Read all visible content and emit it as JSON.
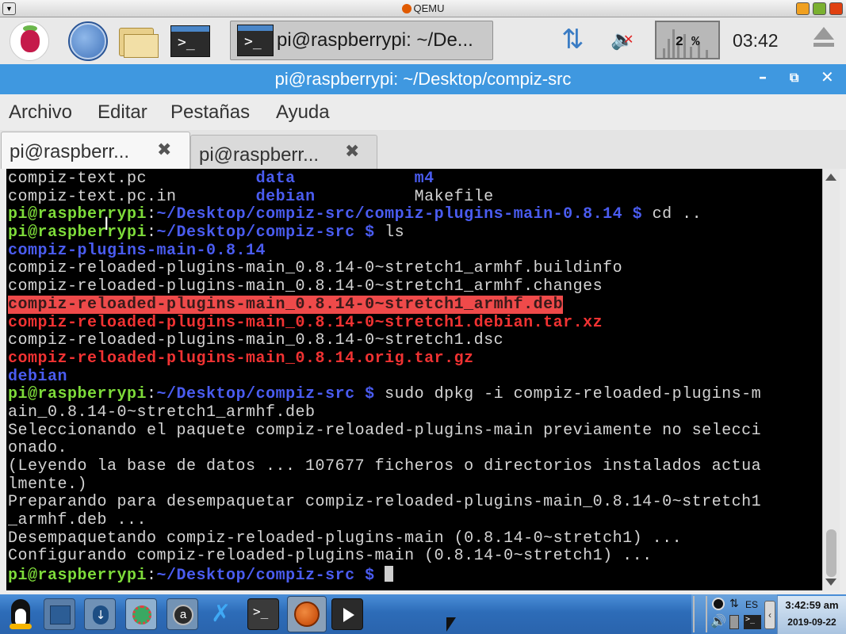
{
  "qemu": {
    "title": "QEMU"
  },
  "panel": {
    "task_label": "pi@raspberrypi: ~/De...",
    "cpu_label": "2 %",
    "clock": "03:42"
  },
  "window": {
    "title": "pi@raspberrypi: ~/Desktop/compiz-src",
    "menu": [
      "Archivo",
      "Editar",
      "Pestañas",
      "Ayuda"
    ],
    "tabs": [
      {
        "label": "pi@raspberr...",
        "active": true
      },
      {
        "label": "pi@raspberr...",
        "active": false
      }
    ]
  },
  "terminal": {
    "lines": [
      [
        {
          "t": "compiz-text.pc           ",
          "c": "white"
        },
        {
          "t": "data",
          "c": "dir"
        },
        {
          "t": "            ",
          "c": "white"
        },
        {
          "t": "m4",
          "c": "dir"
        }
      ],
      [
        {
          "t": "compiz-text.pc.in        ",
          "c": "white"
        },
        {
          "t": "debian",
          "c": "dir"
        },
        {
          "t": "          Makefile",
          "c": "white"
        }
      ],
      [
        {
          "t": "pi@raspberrypi",
          "c": "prompt"
        },
        {
          "t": ":",
          "c": "white"
        },
        {
          "t": "~/Desktop/compiz-src/compiz-plugins-main-0.8.14 $",
          "c": "path"
        },
        {
          "t": " cd ..",
          "c": "white"
        }
      ],
      [
        {
          "t": "pi@raspberrypi",
          "c": "prompt"
        },
        {
          "t": ":",
          "c": "white"
        },
        {
          "t": "~/Desktop/compiz-src $",
          "c": "path"
        },
        {
          "t": " ls",
          "c": "white"
        }
      ],
      [
        {
          "t": "compiz-plugins-main-0.8.14",
          "c": "dir"
        }
      ],
      [
        {
          "t": "compiz-reloaded-plugins-main_0.8.14-0~stretch1_armhf.buildinfo",
          "c": "white"
        }
      ],
      [
        {
          "t": "compiz-reloaded-plugins-main_0.8.14-0~stretch1_armhf.changes",
          "c": "white"
        }
      ],
      [
        {
          "t": "compiz-reloaded-plugins-main_0.8.14-0~stretch1_armhf.deb",
          "c": "hl"
        }
      ],
      [
        {
          "t": "compiz-reloaded-plugins-main_0.8.14-0~stretch1.debian.tar.xz",
          "c": "red"
        }
      ],
      [
        {
          "t": "compiz-reloaded-plugins-main_0.8.14-0~stretch1.dsc",
          "c": "white"
        }
      ],
      [
        {
          "t": "compiz-reloaded-plugins-main_0.8.14.orig.tar.gz",
          "c": "red"
        }
      ],
      [
        {
          "t": "debian",
          "c": "dir"
        }
      ],
      [
        {
          "t": "pi@raspberrypi",
          "c": "prompt"
        },
        {
          "t": ":",
          "c": "white"
        },
        {
          "t": "~/Desktop/compiz-src $",
          "c": "path"
        },
        {
          "t": " sudo dpkg -i compiz-reloaded-plugins-m",
          "c": "white"
        }
      ],
      [
        {
          "t": "ain_0.8.14-0~stretch1_armhf.deb",
          "c": "white"
        }
      ],
      [
        {
          "t": "Seleccionando el paquete compiz-reloaded-plugins-main previamente no selecci",
          "c": "white"
        }
      ],
      [
        {
          "t": "onado.",
          "c": "white"
        }
      ],
      [
        {
          "t": "(Leyendo la base de datos ... 107677 ficheros o directorios instalados actua",
          "c": "white"
        }
      ],
      [
        {
          "t": "lmente.)",
          "c": "white"
        }
      ],
      [
        {
          "t": "Preparando para desempaquetar compiz-reloaded-plugins-main_0.8.14-0~stretch1",
          "c": "white"
        }
      ],
      [
        {
          "t": "_armhf.deb ...",
          "c": "white"
        }
      ],
      [
        {
          "t": "Desempaquetando compiz-reloaded-plugins-main (0.8.14-0~stretch1) ...",
          "c": "white"
        }
      ],
      [
        {
          "t": "Configurando compiz-reloaded-plugins-main (0.8.14-0~stretch1) ...",
          "c": "white"
        }
      ],
      [
        {
          "t": "pi@raspberrypi",
          "c": "prompt"
        },
        {
          "t": ":",
          "c": "white"
        },
        {
          "t": "~/Desktop/compiz-src $",
          "c": "path"
        },
        {
          "t": " ",
          "c": "white"
        }
      ]
    ]
  },
  "taskbar": {
    "tray_lang": "ES",
    "clock_time": "3:42:59 am",
    "clock_date": "2019-09-22"
  },
  "colors": {
    "title_blue": "#3f98e0",
    "prompt_green": "#7edc3a",
    "path_blue": "#4a5cf0",
    "archive_red": "#f03232",
    "highlight_red": "#ef4a4a"
  },
  "icons": [
    "raspberry-icon",
    "globe-icon",
    "folder-icon",
    "terminal-icon",
    "network-icon",
    "volume-muted-icon",
    "eject-icon",
    "minimize-icon",
    "maximize-icon",
    "close-icon",
    "tux-icon",
    "qemu-icon",
    "play-icon"
  ]
}
